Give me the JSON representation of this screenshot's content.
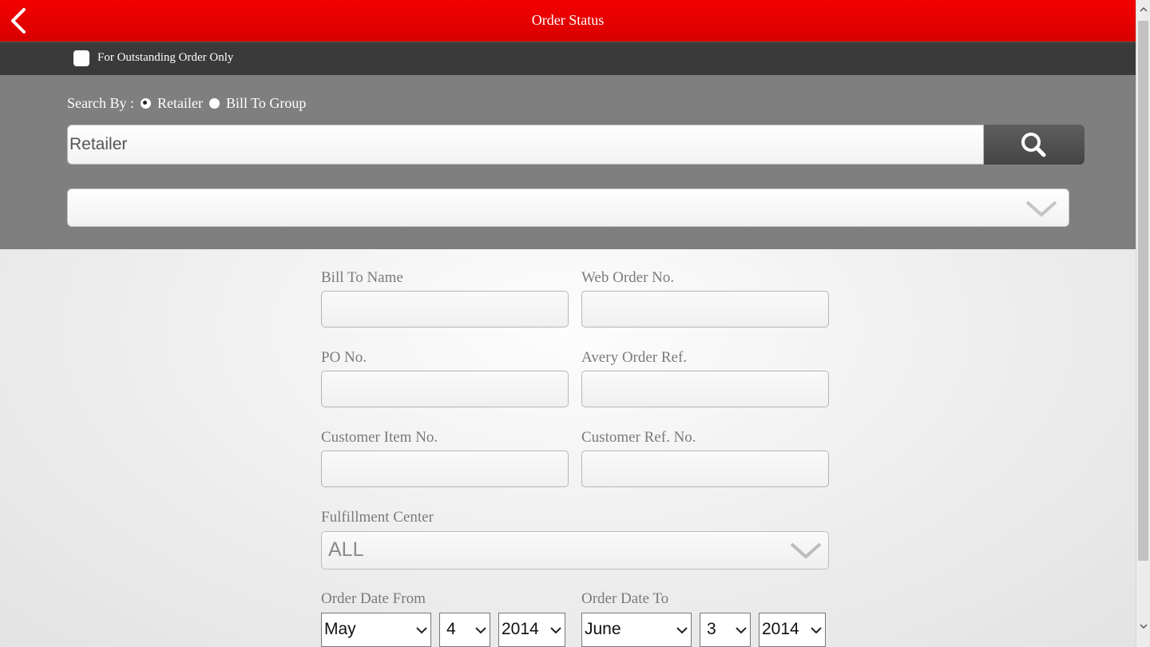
{
  "header": {
    "title": "Order Status",
    "back_icon": "chevron-left-icon",
    "background": "#e00000"
  },
  "outstanding": {
    "label": "For Outstanding Order Only",
    "checked": false
  },
  "search": {
    "search_by_label": "Search By :",
    "options": [
      "Retailer",
      "Bill To Group"
    ],
    "selected_option": "Retailer",
    "placeholder": "Retailer",
    "search_icon": "search-icon",
    "dropdown_value": ""
  },
  "form": {
    "bill_to_name_label": "Bill To Name",
    "web_order_no_label": "Web Order No.",
    "po_no_label": "PO No.",
    "avery_order_ref_label": "Avery Order Ref.",
    "customer_item_no_label": "Customer Item No.",
    "customer_ref_no_label": "Customer Ref. No.",
    "fulfillment_center_label": "Fulfillment Center",
    "fulfillment_center_value": "ALL",
    "order_date_from_label": "Order Date From",
    "order_date_to_label": "Order Date To",
    "date_from": {
      "month": "May",
      "day": "4",
      "year": "2014"
    },
    "date_to": {
      "month": "June",
      "day": "3",
      "year": "2014"
    }
  }
}
